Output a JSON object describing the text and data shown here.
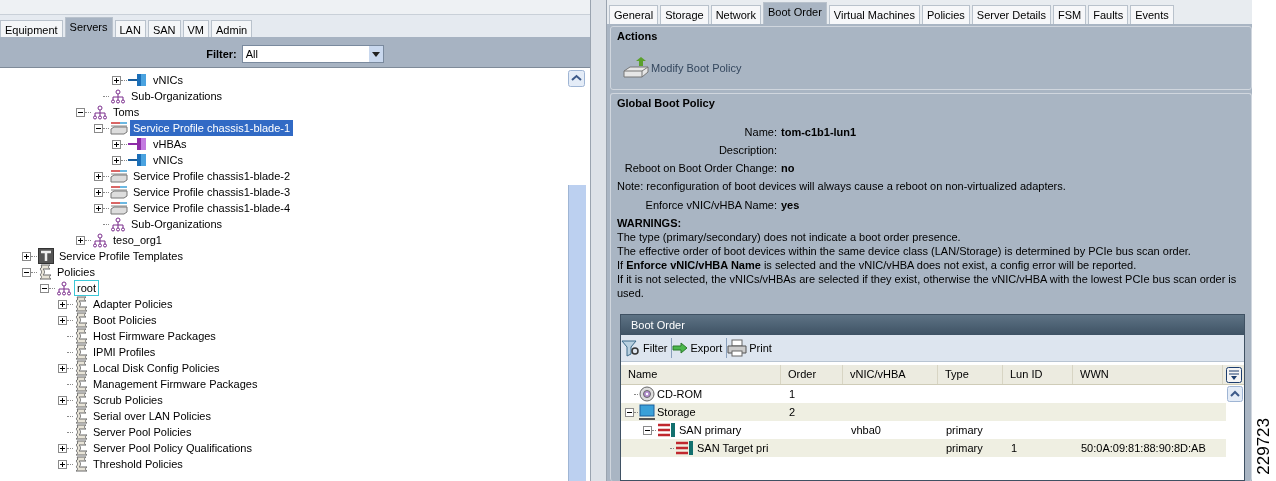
{
  "left_tabs": [
    {
      "label": "Equipment",
      "selected": false
    },
    {
      "label": "Servers",
      "selected": true
    },
    {
      "label": "LAN",
      "selected": false
    },
    {
      "label": "SAN",
      "selected": false
    },
    {
      "label": "VM",
      "selected": false
    },
    {
      "label": "Admin",
      "selected": false
    }
  ],
  "filter": {
    "label": "Filter:",
    "value": "All"
  },
  "tree": [
    {
      "children": [
        {
          "children": [
            {
              "children": [
                {
                  "children": [
                    {
                      "children": [
                        {
                          "label": "vNICs",
                          "kind": "vnic",
                          "expanded": false,
                          "selected": false,
                          "focused": false
                        }
                      ]
                    },
                    {
                      "label": "Sub-Organizations",
                      "kind": "org",
                      "selected": false,
                      "focused": false
                    }
                  ]
                },
                {
                  "label": "Toms",
                  "kind": "org",
                  "expanded": true,
                  "selected": false,
                  "focused": false,
                  "children": [
                    {
                      "label": "Service Profile chassis1-blade-1",
                      "kind": "profile",
                      "expanded": true,
                      "selected": true,
                      "focused": false,
                      "children": [
                        {
                          "label": "vHBAs",
                          "kind": "vhba",
                          "expanded": false,
                          "selected": false,
                          "focused": false
                        },
                        {
                          "label": "vNICs",
                          "kind": "vnic",
                          "expanded": false,
                          "selected": false,
                          "focused": false
                        }
                      ]
                    },
                    {
                      "label": "Service Profile chassis1-blade-2",
                      "kind": "profile",
                      "expanded": false,
                      "selected": false,
                      "focused": false
                    },
                    {
                      "label": "Service Profile chassis1-blade-3",
                      "kind": "profile",
                      "expanded": false,
                      "selected": false,
                      "focused": false
                    },
                    {
                      "label": "Service Profile chassis1-blade-4",
                      "kind": "profile",
                      "expanded": false,
                      "selected": false,
                      "focused": false
                    },
                    {
                      "label": "Sub-Organizations",
                      "kind": "org",
                      "selected": false,
                      "focused": false
                    }
                  ]
                },
                {
                  "label": "teso_org1",
                  "kind": "org",
                  "expanded": false,
                  "selected": false,
                  "focused": false
                }
              ]
            }
          ]
        }
      ]
    },
    {
      "label": "Service Profile Templates",
      "kind": "template",
      "expanded": false,
      "selected": false,
      "focused": false
    },
    {
      "label": "Policies",
      "kind": "policy",
      "expanded": true,
      "selected": false,
      "focused": false,
      "children": [
        {
          "label": "root",
          "kind": "org",
          "expanded": true,
          "selected": false,
          "focused": true,
          "children": [
            {
              "label": "Adapter Policies",
              "kind": "policy",
              "expanded": false,
              "selected": false,
              "focused": false
            },
            {
              "label": "Boot Policies",
              "kind": "policy",
              "expanded": false,
              "selected": false,
              "focused": false
            },
            {
              "label": "Host Firmware Packages",
              "kind": "policy",
              "selected": false,
              "focused": false
            },
            {
              "label": "IPMI Profiles",
              "kind": "policy",
              "selected": false,
              "focused": false
            },
            {
              "label": "Local Disk Config Policies",
              "kind": "policy",
              "expanded": false,
              "selected": false,
              "focused": false
            },
            {
              "label": "Management Firmware Packages",
              "kind": "policy",
              "selected": false,
              "focused": false
            },
            {
              "label": "Scrub Policies",
              "kind": "policy",
              "expanded": false,
              "selected": false,
              "focused": false
            },
            {
              "label": "Serial over LAN Policies",
              "kind": "policy",
              "selected": false,
              "focused": false
            },
            {
              "label": "Server Pool Policies",
              "kind": "policy",
              "selected": false,
              "focused": false
            },
            {
              "label": "Server Pool Policy Qualifications",
              "kind": "policy",
              "expanded": false,
              "selected": false,
              "focused": false
            },
            {
              "label": "Threshold Policies",
              "kind": "policy",
              "expanded": false,
              "selected": false,
              "focused": false
            }
          ]
        }
      ]
    }
  ],
  "right_tabs": [
    {
      "label": "General",
      "selected": false
    },
    {
      "label": "Storage",
      "selected": false
    },
    {
      "label": "Network",
      "selected": false
    },
    {
      "label": "Boot Order",
      "selected": true
    },
    {
      "label": "Virtual Machines",
      "selected": false
    },
    {
      "label": "Policies",
      "selected": false
    },
    {
      "label": "Server Details",
      "selected": false
    },
    {
      "label": "FSM",
      "selected": false
    },
    {
      "label": "Faults",
      "selected": false
    },
    {
      "label": "Events",
      "selected": false
    }
  ],
  "actions": {
    "title": "Actions",
    "items": [
      "Modify Boot Policy"
    ]
  },
  "global_boot_policy": {
    "title": "Global Boot Policy",
    "fields": [
      {
        "kind": "field",
        "label": "Name:",
        "value": "tom-c1b1-lun1"
      },
      {
        "kind": "field",
        "label": "Description:"
      },
      {
        "kind": "field",
        "label": "Reboot on Boot Order Change:",
        "value": "no"
      },
      {
        "kind": "note",
        "text": "Note: reconfiguration of boot devices will always cause a reboot on non-virtualized adapters."
      },
      {
        "kind": "field",
        "label": "Enforce vNIC/vHBA Name:",
        "value": "yes"
      }
    ],
    "warnings_title": "WARNINGS:",
    "warnings": [
      "The type (primary/secondary) does not indicate a boot order presence.",
      "The effective order of boot devices within the same device class (LAN/Storage) is determined by PCIe bus scan order.",
      "If **Enforce vNIC/vHBA Name** is selected and the vNIC/vHBA does not exist, a config error will be reported.",
      "If it is not selected, the vNICs/vHBAs are selected if they exist, otherwise the vNIC/vHBA with the lowest PCIe bus scan order is used."
    ]
  },
  "boot_order": {
    "title": "Boot Order",
    "toolbar": [
      {
        "kind": "filter",
        "label": "Filter"
      },
      {
        "kind": "export",
        "label": "Export"
      },
      {
        "kind": "print",
        "label": "Print"
      }
    ],
    "columns": [
      "Name",
      "Order",
      "vNIC/vHBA",
      "Type",
      "Lun ID",
      "WWN"
    ],
    "rows": [
      {
        "kind": "cdrom",
        "cells": [
          "CD-ROM",
          "1",
          "",
          "",
          "",
          ""
        ]
      },
      {
        "kind": "storage",
        "expanded": true,
        "cells": [
          "Storage",
          "2",
          "",
          "",
          "",
          ""
        ],
        "children": [
          {
            "kind": "san",
            "expanded": true,
            "cells": [
              "SAN primary",
              "",
              "vhba0",
              "primary",
              "",
              ""
            ],
            "children": [
              {
                "kind": "san",
                "cells": [
                  "SAN Target pri",
                  "",
                  "",
                  "primary",
                  "1",
                  "50:0A:09:81:88:90:8D:AB"
                ]
              }
            ]
          }
        ]
      }
    ]
  },
  "figure_id": "229723"
}
